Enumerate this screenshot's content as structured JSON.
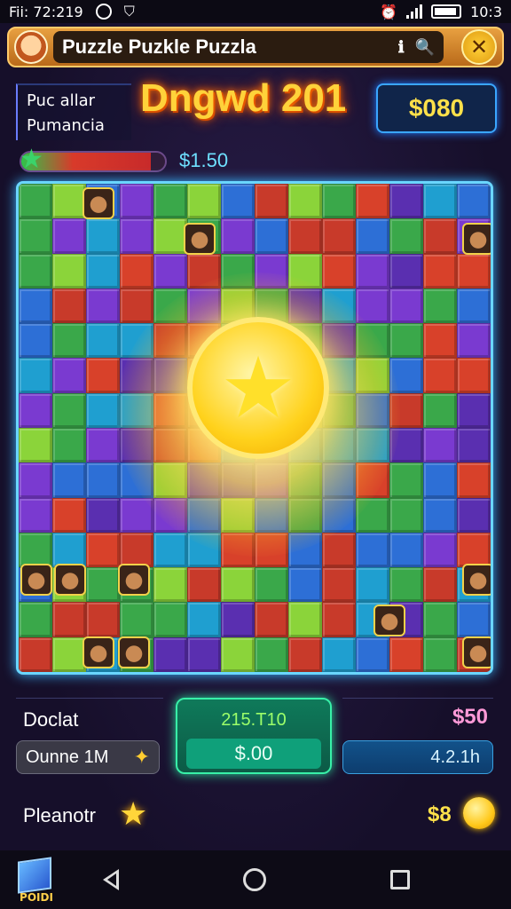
{
  "status_bar": {
    "time": "Fii: 72:219",
    "clock": "10:3"
  },
  "title_bar": {
    "title": "Puzzle Puzkle Puzzla",
    "info_icon": "info-icon",
    "search_icon": "search-icon",
    "close_icon": "close-icon"
  },
  "header": {
    "info_line1": "Puc allar",
    "info_line2": "Pumancia",
    "level_title": "Dngwd 201",
    "money": "$080",
    "progress_value": "$1.50",
    "progress_fraction": 0.9
  },
  "bottom": {
    "left_label": "Doclat",
    "center_top": "215.T10",
    "center_value": "$.00",
    "right_value": "$50",
    "left_pill": "Ounne 1M",
    "right_pill": "4.2.1h",
    "bonus_label": "Pleanotr",
    "coins": "$8"
  },
  "navbar": {
    "app_label": "POIDI"
  },
  "colors": {
    "accent": "#ffd23a",
    "board_border": "#6ad6ff",
    "primary_button": "#0f7a5a"
  }
}
